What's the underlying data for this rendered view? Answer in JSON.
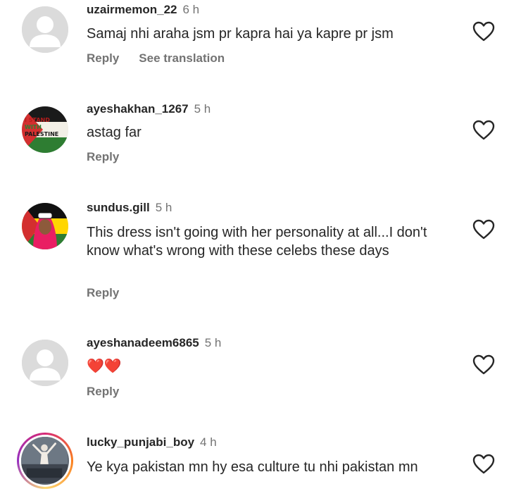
{
  "comments": [
    {
      "username": "uzairmemon_22",
      "time": "6 h",
      "text": "Samaj nhi araha  jsm pr kapra hai ya kapre pr jsm",
      "reply": "Reply",
      "translate": "See translation",
      "avatar": "default-avatar"
    },
    {
      "username": "ayeshakhan_1267",
      "time": "5 h",
      "text": "astag far",
      "reply": "Reply",
      "avatar": "palestine-avatar",
      "avatar_text": [
        "I STAND",
        "WITH",
        "PALESTINE"
      ]
    },
    {
      "username": "sundus.gill",
      "time": "5 h",
      "text": "This dress isn't going with her personality at all...I don't know what's wrong with these celebs these days",
      "reply": "Reply",
      "avatar": "illustrated-avatar"
    },
    {
      "username": "ayeshanadeem6865",
      "time": "5 h",
      "text": "❤️❤️",
      "reply": "Reply",
      "avatar": "default-avatar"
    },
    {
      "username": "lucky_punjabi_boy",
      "time": "4 h",
      "text": "Ye kya pakistan mn hy esa culture tu nhi pakistan mn",
      "avatar": "story-ring-avatar"
    }
  ],
  "icons": {
    "like": "heart-outline-icon"
  },
  "colors": {
    "text": "#262626",
    "secondary": "#737373",
    "divider": "#dbdbdb"
  }
}
